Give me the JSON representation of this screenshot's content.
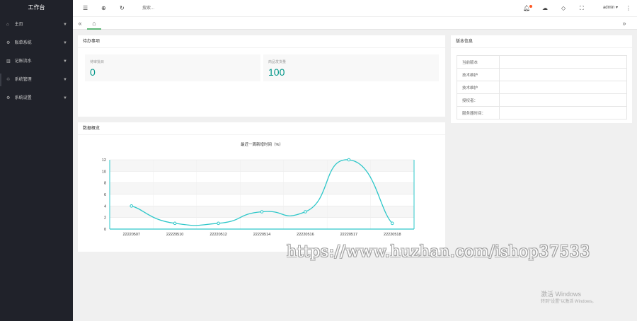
{
  "sidebar": {
    "title": "工作台",
    "items": [
      {
        "icon": "⌂",
        "label": "主页",
        "caret": "▼"
      },
      {
        "icon": "⚙",
        "label": "账单系统",
        "caret": "▼"
      },
      {
        "icon": "▥",
        "label": "记账流水",
        "caret": "▼"
      },
      {
        "icon": "♲",
        "label": "系统管理",
        "caret": "▼"
      },
      {
        "icon": "⚙",
        "label": "系统设置",
        "caret": "▼"
      }
    ]
  },
  "header": {
    "search_placeholder": "搜索...",
    "icons": {
      "menu": "☰",
      "globe": "⊕",
      "refresh": "↻",
      "bell": "🔔︎",
      "theme": "☁",
      "tag": "◇",
      "fullscreen": "⛶",
      "more": "⋮"
    },
    "user": "admin ▾"
  },
  "tabs": {
    "prev": "«",
    "home": "⌂",
    "next": "»"
  },
  "todo": {
    "title": "待办事项",
    "stats": [
      {
        "label": "待审批目",
        "value": "0"
      },
      {
        "label": "商品发货量",
        "value": "100"
      }
    ]
  },
  "version": {
    "title": "版本信息",
    "rows": [
      {
        "key": "当前版本",
        "value": ""
      },
      {
        "key": "技术维护",
        "value": ""
      },
      {
        "key": "技术维护",
        "value": ""
      },
      {
        "key": "授权者：",
        "value": ""
      },
      {
        "key": "服务器时间：",
        "value": ""
      }
    ]
  },
  "overview": {
    "title": "数据概览"
  },
  "chart_data": {
    "type": "line",
    "title": "最近一周新增时间（%）",
    "categories": [
      "22220507",
      "22220510",
      "22220512",
      "22220514",
      "22220516",
      "22220517",
      "22220518"
    ],
    "series": [
      {
        "values": [
          4,
          1,
          1,
          3,
          3,
          12,
          1
        ]
      }
    ],
    "yticks": [
      0,
      2,
      4,
      6,
      8,
      10,
      12
    ],
    "ylim": [
      0,
      12
    ],
    "grid": true,
    "line_color": "#2ec7c9"
  },
  "watermark": "https://www.huzhan.com/ishop37533",
  "activation": {
    "line1": "激活 Windows",
    "line2": "转到\"设置\"以激活 Windows。"
  }
}
